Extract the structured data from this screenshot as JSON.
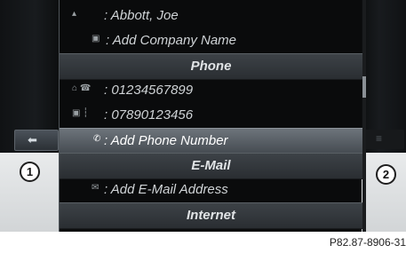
{
  "contact": {
    "name_row": ": Abbott, Joe",
    "company_row": ": Add Company Name"
  },
  "sections": {
    "phone_header": "Phone",
    "email_header": "E-Mail",
    "internet_header": "Internet"
  },
  "phone": {
    "home_number": ": 01234567899",
    "mobile_number": ": 07890123456",
    "add_number": ": Add Phone Number"
  },
  "email": {
    "add_address": ": Add E-Mail Address"
  },
  "markers": {
    "left": "1",
    "right": "2"
  },
  "icons": {
    "person": "person-icon",
    "company": "building-icon",
    "home_phone": "home-phone-icon",
    "mobile": "mobile-phone-icon",
    "add_phone": "handset-icon",
    "email": "email-icon",
    "back": "back-arrow-icon"
  },
  "colors": {
    "screen_background": "#0a0b0c",
    "header_background": "#3d4247",
    "selected_background": "#6d747b",
    "text": "#cfd3d6"
  },
  "caption": "P82.87-8906-31"
}
